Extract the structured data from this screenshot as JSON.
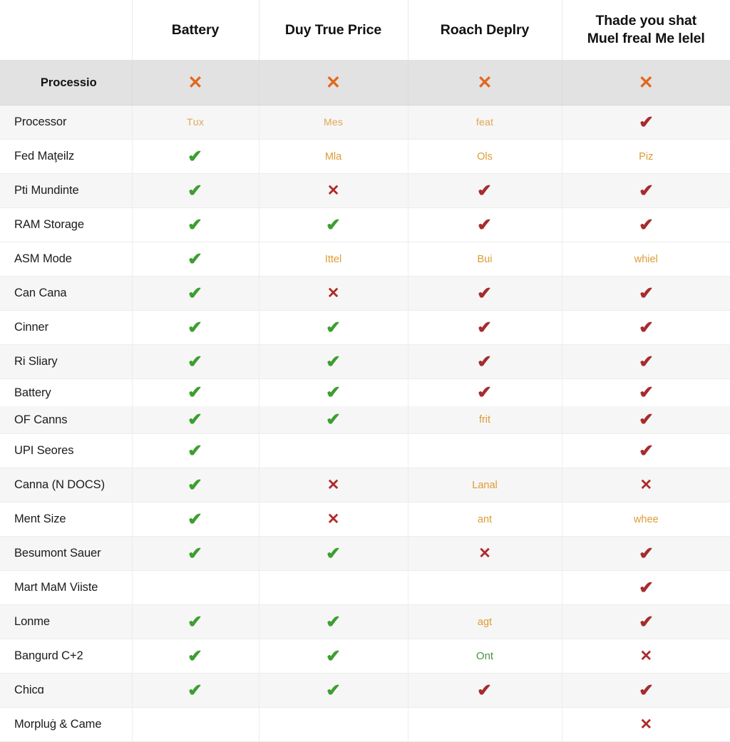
{
  "table": {
    "columns": [
      {
        "key": "label",
        "label": ""
      },
      {
        "key": "col1",
        "label": "Battery"
      },
      {
        "key": "col2",
        "label": "Duy True Price"
      },
      {
        "key": "col3",
        "label": "Roach Deplry"
      },
      {
        "key": "col4",
        "label": "Thade you shat\nMuel freal Me lelel"
      }
    ],
    "section": {
      "label": "Processio",
      "cells": [
        {
          "kind": "cross-orange",
          "glyph": "✕"
        },
        {
          "kind": "cross-orange",
          "glyph": "✕"
        },
        {
          "kind": "cross-orange",
          "glyph": "✕"
        },
        {
          "kind": "cross-orange",
          "glyph": "✕"
        }
      ]
    },
    "colors": {
      "check_green": "#3d9e31",
      "check_red": "#a62c2c",
      "cross_red": "#b02a2a",
      "cross_orange": "#e2671f",
      "text_tan": "#e0a650",
      "text_orange": "#dd9b33",
      "text_green": "#4a9340",
      "row_alt_bg": "#f6f6f6",
      "row_bg": "#ffffff",
      "section_bg": "#e2e2e2",
      "grid_line": "#ececec"
    },
    "rows": [
      {
        "label": "Processor",
        "stripe": "alt",
        "size": "normal",
        "cells": [
          {
            "kind": "text-tan",
            "glyph": "Tʊx"
          },
          {
            "kind": "text-tan",
            "glyph": "Mes"
          },
          {
            "kind": "text-tan",
            "glyph": "feat"
          },
          {
            "kind": "check-red",
            "glyph": "✔"
          }
        ]
      },
      {
        "label": "Fed Maţeilz",
        "stripe": "plain",
        "size": "normal",
        "cells": [
          {
            "kind": "check-green",
            "glyph": "✔"
          },
          {
            "kind": "text-orange",
            "glyph": "Mla"
          },
          {
            "kind": "text-orange",
            "glyph": "Ols"
          },
          {
            "kind": "text-orange",
            "glyph": "Piz"
          }
        ]
      },
      {
        "label": "Pti Mundinte",
        "stripe": "alt",
        "size": "normal",
        "cells": [
          {
            "kind": "check-green",
            "glyph": "✔"
          },
          {
            "kind": "cross-red",
            "glyph": "✕"
          },
          {
            "kind": "check-red",
            "glyph": "✔"
          },
          {
            "kind": "check-red",
            "glyph": "✔"
          }
        ]
      },
      {
        "label": "RAM Storage",
        "stripe": "plain",
        "size": "normal",
        "cells": [
          {
            "kind": "check-green",
            "glyph": "✔"
          },
          {
            "kind": "check-green",
            "glyph": "✔"
          },
          {
            "kind": "check-red",
            "glyph": "✔"
          },
          {
            "kind": "check-red",
            "glyph": "✔"
          }
        ]
      },
      {
        "label": "ASM Mode",
        "stripe": "plain",
        "size": "normal",
        "cells": [
          {
            "kind": "check-green",
            "glyph": "✔"
          },
          {
            "kind": "text-orange",
            "glyph": "Ittel"
          },
          {
            "kind": "text-orange",
            "glyph": "Bui"
          },
          {
            "kind": "text-orange",
            "glyph": "whiel"
          }
        ]
      },
      {
        "label": "Can Cana",
        "stripe": "alt",
        "size": "normal",
        "cells": [
          {
            "kind": "check-green",
            "glyph": "✔"
          },
          {
            "kind": "cross-red",
            "glyph": "✕"
          },
          {
            "kind": "check-red",
            "glyph": "✔"
          },
          {
            "kind": "check-red",
            "glyph": "✔"
          }
        ]
      },
      {
        "label": "Cinner",
        "stripe": "plain",
        "size": "normal",
        "cells": [
          {
            "kind": "check-green",
            "glyph": "✔"
          },
          {
            "kind": "check-green",
            "glyph": "✔"
          },
          {
            "kind": "check-red",
            "glyph": "✔"
          },
          {
            "kind": "check-red",
            "glyph": "✔"
          }
        ]
      },
      {
        "label": "Ri Sliary",
        "stripe": "alt",
        "size": "normal",
        "cells": [
          {
            "kind": "check-green",
            "glyph": "✔"
          },
          {
            "kind": "check-green",
            "glyph": "✔"
          },
          {
            "kind": "check-red",
            "glyph": "✔"
          },
          {
            "kind": "check-red",
            "glyph": "✔"
          }
        ]
      },
      {
        "label": "Battery",
        "stripe": "plain",
        "size": "compact-top",
        "cells": [
          {
            "kind": "check-green",
            "glyph": "✔"
          },
          {
            "kind": "check-green",
            "glyph": "✔"
          },
          {
            "kind": "check-red",
            "glyph": "✔"
          },
          {
            "kind": "check-red",
            "glyph": "✔"
          }
        ]
      },
      {
        "label": "OF Canns",
        "stripe": "alt",
        "size": "compact",
        "cells": [
          {
            "kind": "check-green",
            "glyph": "✔"
          },
          {
            "kind": "check-green",
            "glyph": "✔"
          },
          {
            "kind": "text-orange",
            "glyph": "frit"
          },
          {
            "kind": "check-red",
            "glyph": "✔"
          }
        ]
      },
      {
        "label": "UPI Seores",
        "stripe": "plain",
        "size": "normal",
        "cells": [
          {
            "kind": "check-green",
            "glyph": "✔"
          },
          {
            "kind": "blank",
            "glyph": ""
          },
          {
            "kind": "blank",
            "glyph": ""
          },
          {
            "kind": "check-red",
            "glyph": "✔"
          }
        ]
      },
      {
        "label": "Canna (N DOCS)",
        "stripe": "alt",
        "size": "normal",
        "cells": [
          {
            "kind": "check-green",
            "glyph": "✔"
          },
          {
            "kind": "cross-red",
            "glyph": "✕"
          },
          {
            "kind": "text-orange",
            "glyph": "Lanal"
          },
          {
            "kind": "cross-red",
            "glyph": "✕"
          }
        ]
      },
      {
        "label": "Ment Size",
        "stripe": "plain",
        "size": "normal",
        "cells": [
          {
            "kind": "check-green",
            "glyph": "✔"
          },
          {
            "kind": "cross-red",
            "glyph": "✕"
          },
          {
            "kind": "text-orange",
            "glyph": "ant"
          },
          {
            "kind": "text-orange",
            "glyph": "whee"
          }
        ]
      },
      {
        "label": "Besumont Sauer",
        "stripe": "alt",
        "size": "normal",
        "cells": [
          {
            "kind": "check-green",
            "glyph": "✔"
          },
          {
            "kind": "check-green",
            "glyph": "✔"
          },
          {
            "kind": "cross-red",
            "glyph": "✕"
          },
          {
            "kind": "check-red",
            "glyph": "✔"
          }
        ]
      },
      {
        "label": "Mart MaM Viiste",
        "stripe": "plain",
        "size": "normal",
        "cells": [
          {
            "kind": "blank",
            "glyph": ""
          },
          {
            "kind": "blank",
            "glyph": ""
          },
          {
            "kind": "blank",
            "glyph": ""
          },
          {
            "kind": "check-red",
            "glyph": "✔"
          }
        ]
      },
      {
        "label": "Lonme",
        "stripe": "alt",
        "size": "normal",
        "cells": [
          {
            "kind": "check-green",
            "glyph": "✔"
          },
          {
            "kind": "check-green",
            "glyph": "✔"
          },
          {
            "kind": "text-orange",
            "glyph": "agt"
          },
          {
            "kind": "check-red",
            "glyph": "✔"
          }
        ]
      },
      {
        "label": "Bangurd C+2",
        "stripe": "plain",
        "size": "normal",
        "cells": [
          {
            "kind": "check-green",
            "glyph": "✔"
          },
          {
            "kind": "check-green",
            "glyph": "✔"
          },
          {
            "kind": "text-green",
            "glyph": "Ont"
          },
          {
            "kind": "cross-red",
            "glyph": "✕"
          }
        ]
      },
      {
        "label": "Chicɑ",
        "stripe": "alt",
        "size": "normal",
        "cells": [
          {
            "kind": "check-green",
            "glyph": "✔"
          },
          {
            "kind": "check-green",
            "glyph": "✔"
          },
          {
            "kind": "check-red",
            "glyph": "✔"
          },
          {
            "kind": "check-red",
            "glyph": "✔"
          }
        ]
      },
      {
        "label": "Morpluġ & Came",
        "stripe": "plain",
        "size": "normal",
        "cells": [
          {
            "kind": "blank",
            "glyph": ""
          },
          {
            "kind": "blank",
            "glyph": ""
          },
          {
            "kind": "blank",
            "glyph": ""
          },
          {
            "kind": "cross-red",
            "glyph": "✕"
          }
        ]
      }
    ]
  }
}
